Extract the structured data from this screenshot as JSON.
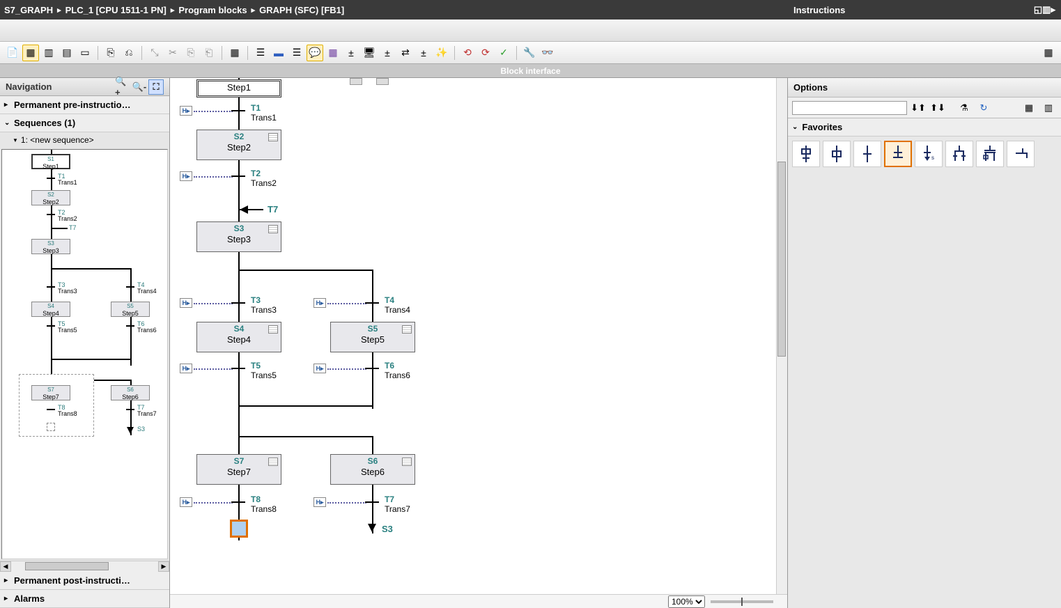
{
  "titlebar": {
    "crumbs": [
      "S7_GRAPH",
      "PLC_1 [CPU 1511-1 PN]",
      "Program blocks",
      "GRAPH (SFC) [FB1]"
    ]
  },
  "block_interface_label": "Block interface",
  "nav": {
    "title": "Navigation",
    "pre_section": "Permanent pre-instructio…",
    "seq_section": "Sequences (1)",
    "seq_item": "1: <new sequence>",
    "post_section": "Permanent post-instructi…",
    "alarms_section": "Alarms"
  },
  "mini": {
    "steps": [
      {
        "id": "S1",
        "name": "Step1"
      },
      {
        "id": "S2",
        "name": "Step2"
      },
      {
        "id": "S3",
        "name": "Step3"
      },
      {
        "id": "S4",
        "name": "Step4"
      },
      {
        "id": "S5",
        "name": "Step5"
      },
      {
        "id": "S6",
        "name": "Step6"
      },
      {
        "id": "S7",
        "name": "Step7"
      }
    ],
    "trans": [
      {
        "id": "T1",
        "name": "Trans1"
      },
      {
        "id": "T2",
        "name": "Trans2"
      },
      {
        "id": "T3",
        "name": "Trans3"
      },
      {
        "id": "T4",
        "name": "Trans4"
      },
      {
        "id": "T5",
        "name": "Trans5"
      },
      {
        "id": "T6",
        "name": "Trans6"
      },
      {
        "id": "T7",
        "name": "Trans7"
      },
      {
        "id": "T8",
        "name": "Trans8"
      }
    ],
    "jump_in": "T7",
    "jump_to": "S3"
  },
  "editor": {
    "steps": {
      "s1": {
        "id": "",
        "name": "Step1"
      },
      "s2": {
        "id": "S2",
        "name": "Step2"
      },
      "s3": {
        "id": "S3",
        "name": "Step3"
      },
      "s4": {
        "id": "S4",
        "name": "Step4"
      },
      "s5": {
        "id": "S5",
        "name": "Step5"
      },
      "s6": {
        "id": "S6",
        "name": "Step6"
      },
      "s7": {
        "id": "S7",
        "name": "Step7"
      }
    },
    "trans": {
      "t1": {
        "id": "T1",
        "name": "Trans1"
      },
      "t2": {
        "id": "T2",
        "name": "Trans2"
      },
      "t3": {
        "id": "T3",
        "name": "Trans3"
      },
      "t4": {
        "id": "T4",
        "name": "Trans4"
      },
      "t5": {
        "id": "T5",
        "name": "Trans5"
      },
      "t6": {
        "id": "T6",
        "name": "Trans6"
      },
      "t7": {
        "id": "T7",
        "name": "Trans7"
      },
      "t8": {
        "id": "T8",
        "name": "Trans8"
      }
    },
    "jump_in_label": "T7",
    "jump_to_label": "S3",
    "zoom": "100%"
  },
  "instructions": {
    "title": "Instructions",
    "options": "Options",
    "favorites": "Favorites",
    "search_placeholder": ""
  }
}
